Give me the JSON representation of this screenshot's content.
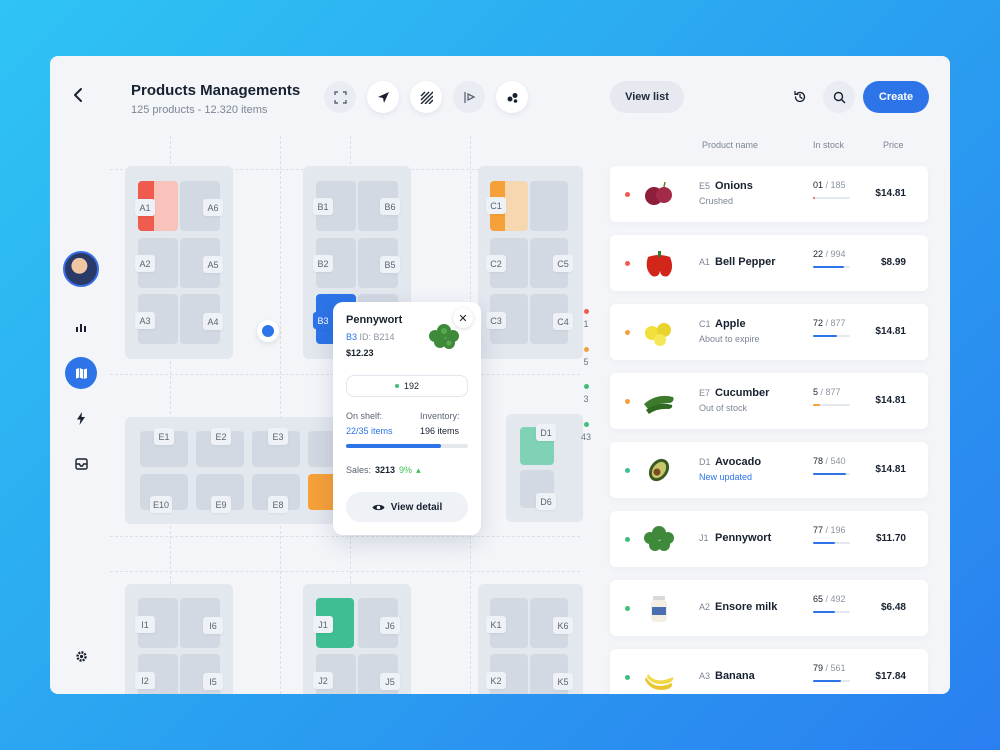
{
  "header": {
    "title": "Products Managements",
    "subtitle": "125 products - 12.320 items",
    "view_list": "View list",
    "create": "Create"
  },
  "toolbar_icons": [
    "expand-icon",
    "navigate-icon",
    "hatch-icon",
    "flag-icon",
    "cluster-icon"
  ],
  "map": {
    "zone_a": [
      "A1",
      "A6",
      "A2",
      "A5",
      "A3",
      "A4"
    ],
    "zone_b": [
      "B1",
      "B6",
      "B2",
      "B5",
      "B3"
    ],
    "zone_c": [
      "C1",
      "C2",
      "C5",
      "C3",
      "C4"
    ],
    "zone_e": [
      "E1",
      "E2",
      "E3",
      "E10",
      "E9",
      "E8"
    ],
    "zone_d": [
      "D1",
      "D6"
    ],
    "zone_i": [
      "I1",
      "I6",
      "I2",
      "I5"
    ],
    "zone_j": [
      "J1",
      "J6",
      "J2",
      "J5"
    ],
    "zone_k": [
      "K1",
      "K6",
      "K2",
      "K5"
    ],
    "legend": [
      {
        "color": "#ef5b4f",
        "count": "1"
      },
      {
        "color": "#f6a03a",
        "count": "5"
      },
      {
        "color": "#3fbe7a",
        "count": "3"
      },
      {
        "color": "#3fbe7a",
        "count": "43"
      }
    ]
  },
  "popup": {
    "name": "Pennywort",
    "location": "B3",
    "id_text": "ID: B214",
    "price": "$12.23",
    "count": "192",
    "on_shelf_label": "On shelf:",
    "on_shelf_value": "22/35 items",
    "inventory_label": "Inventory:",
    "inventory_value": "196 items",
    "progress": 0.78,
    "sales_label": "Sales:",
    "sales_value": "3213",
    "sales_change": "9%",
    "view_detail": "View detail"
  },
  "list": {
    "headers": {
      "name": "Product name",
      "stock": "In stock",
      "price": "Price"
    },
    "rows": [
      {
        "code": "E5",
        "name": "Onions",
        "sub": "Crushed",
        "in": "01",
        "total": "/ 185",
        "pct": 0.05,
        "price": "$14.81",
        "status": "#ef5b4f",
        "bar": "#ef5b4f",
        "subcolor": "",
        "img": "onion"
      },
      {
        "code": "A1",
        "name": "Bell Pepper",
        "sub": "",
        "in": "22",
        "total": "/ 994",
        "pct": 0.85,
        "price": "$8.99",
        "status": "#ef5b4f",
        "bar": "#2d74e8",
        "subcolor": "",
        "img": "pepper"
      },
      {
        "code": "C1",
        "name": "Apple",
        "sub": "About to expire",
        "in": "72",
        "total": "/ 877",
        "pct": 0.65,
        "price": "$14.81",
        "status": "#f6a03a",
        "bar": "#2d74e8",
        "subcolor": "",
        "img": "apple"
      },
      {
        "code": "E7",
        "name": "Cucumber",
        "sub": "Out of stock",
        "in": "5",
        "total": "/ 877",
        "pct": 0.2,
        "price": "$14.81",
        "status": "#f6a03a",
        "bar": "#f6a03a",
        "subcolor": "",
        "img": "cucumber"
      },
      {
        "code": "D1",
        "name": "Avocado",
        "sub": "New updated",
        "in": "78",
        "total": "/ 540",
        "pct": 0.9,
        "price": "$14.81",
        "status": "#3fbe93",
        "bar": "#2d74e8",
        "subcolor": "blue",
        "img": "avocado"
      },
      {
        "code": "J1",
        "name": "Pennywort",
        "sub": "",
        "in": "77",
        "total": "/ 196",
        "pct": 0.6,
        "price": "$11.70",
        "status": "#3fbe7a",
        "bar": "#2d74e8",
        "subcolor": "",
        "img": "herb"
      },
      {
        "code": "A2",
        "name": "Ensore milk",
        "sub": "",
        "in": "65",
        "total": "/ 492",
        "pct": 0.6,
        "price": "$6.48",
        "status": "#3fbe7a",
        "bar": "#2d74e8",
        "subcolor": "",
        "img": "milk"
      },
      {
        "code": "A3",
        "name": "Banana",
        "sub": "",
        "in": "79",
        "total": "/ 561",
        "pct": 0.75,
        "price": "$17.84",
        "status": "#3fbe7a",
        "bar": "#2d74e8",
        "subcolor": "",
        "img": "banana"
      }
    ]
  }
}
